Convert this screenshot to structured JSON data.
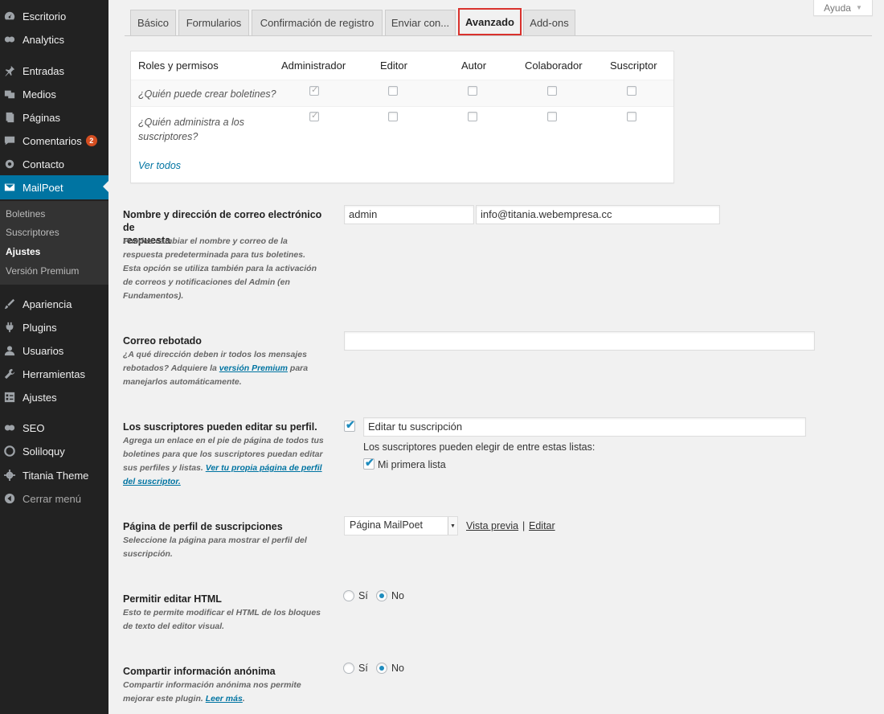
{
  "sidebar": {
    "items": [
      {
        "label": "Escritorio",
        "icon": "dashboard-icon"
      },
      {
        "label": "Analytics",
        "icon": "analytics-icon"
      },
      {
        "label": "Entradas",
        "icon": "pin-icon"
      },
      {
        "label": "Medios",
        "icon": "media-icon"
      },
      {
        "label": "Páginas",
        "icon": "pages-icon"
      },
      {
        "label": "Comentarios",
        "icon": "comment-icon",
        "badge": "2"
      },
      {
        "label": "Contacto",
        "icon": "contact-icon"
      },
      {
        "label": "MailPoet",
        "icon": "mail-icon"
      },
      {
        "label": "Apariencia",
        "icon": "appearance-icon"
      },
      {
        "label": "Plugins",
        "icon": "plugins-icon"
      },
      {
        "label": "Usuarios",
        "icon": "users-icon"
      },
      {
        "label": "Herramientas",
        "icon": "tools-icon"
      },
      {
        "label": "Ajustes",
        "icon": "settings-icon"
      },
      {
        "label": "SEO",
        "icon": "seo-icon"
      },
      {
        "label": "Soliloquy",
        "icon": "soliloquy-icon"
      },
      {
        "label": "Titania Theme",
        "icon": "gear-icon"
      },
      {
        "label": "Cerrar menú",
        "icon": "collapse-icon"
      }
    ],
    "submenu": [
      "Boletines",
      "Suscriptores",
      "Ajustes",
      "Versión Premium"
    ]
  },
  "help": {
    "label": "Ayuda"
  },
  "tabs": [
    "Básico",
    "Formularios",
    "Confirmación de registro",
    "Enviar con...",
    "Avanzado",
    "Add-ons"
  ],
  "permissions": {
    "headers": [
      "Roles y permisos",
      "Administrador",
      "Editor",
      "Autor",
      "Colaborador",
      "Suscriptor"
    ],
    "rows": [
      {
        "question": "¿Quién puede crear boletines?"
      },
      {
        "question_line1": "¿Quién administra a los",
        "question_line2": "suscriptores?"
      }
    ],
    "view_all": "Ver todos"
  },
  "settings": {
    "reply": {
      "label_l1": "Nombre y dirección de correo electrónico de",
      "label_l2": "respuesta",
      "desc": [
        "Puedes cambiar el nombre y correo de la",
        "respuesta predeterminada para tus boletines.",
        "Esta opción se utiliza también para la activación",
        "de correos y notificaciones del Admin (en",
        "Fundamentos)."
      ],
      "name_value": "admin",
      "email_value": "info@titania.webempresa.cc"
    },
    "bounce": {
      "label": "Correo rebotado",
      "desc_l1": "¿A qué dirección deben ir todos los mensajes",
      "desc_l2_pre": "rebotados? Adquiere la ",
      "desc_l2_link": "versión Premium",
      "desc_l2_post": " para",
      "desc_l3": "manejarlos automáticamente.",
      "value": ""
    },
    "edit_profile": {
      "label": "Los suscriptores pueden editar su perfil.",
      "desc": [
        "Agrega un enlace en el pie de página de todos tus",
        "boletines para que los suscriptores puedan editar"
      ],
      "desc_l3_pre": "sus perfiles y listas. ",
      "desc_l3_link": "Ver tu propia página de perfil",
      "desc_l4_link": "del suscriptor.",
      "input_value": "Editar tu suscripción",
      "lists_caption": "Los suscriptores pueden elegir de entre estas listas:",
      "list_item": "Mi primera lista",
      "enabled": true,
      "list_checked": true
    },
    "profile_page": {
      "label": "Página de perfil de suscripciones",
      "desc": [
        "Seleccione la página para mostrar el perfil del",
        "suscripción."
      ],
      "selected": "Página MailPoet",
      "preview_link": "Vista previa",
      "separator": "|",
      "edit_link": "Editar"
    },
    "html_edit": {
      "label": "Permitir editar HTML",
      "desc": [
        "Esto te permite modificar el HTML de los bloques",
        "de texto del editor visual."
      ],
      "yes": "Sí",
      "no": "No",
      "selected": "No"
    },
    "anonymous": {
      "label": "Compartir información anónima",
      "desc_l1": "Compartir información anónima nos permite",
      "desc_l2_pre": "mejorar este plugin. ",
      "desc_l2_link": "Leer más",
      "desc_l2_post": ".",
      "yes": "Sí",
      "no": "No",
      "selected": "No"
    }
  },
  "colors": {
    "accent": "#0074a2",
    "highlight_border": "#d9322d",
    "sidebar_bg": "#222222",
    "badge": "#d54e21"
  }
}
